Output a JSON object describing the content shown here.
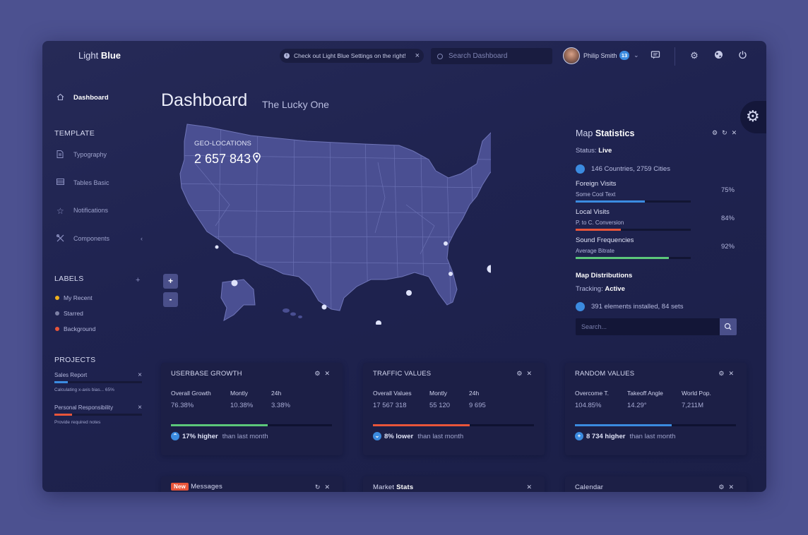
{
  "header": {
    "logo_light": "Light",
    "logo_bold": "Blue",
    "notice_text": "Check out Light Blue Settings on the right!",
    "search_placeholder": "Search Dashboard",
    "user_name": "Philip Smith",
    "notification_count": "13"
  },
  "sidebar": {
    "active_item": "Dashboard",
    "template_heading": "TEMPLATE",
    "items": [
      {
        "label": "Typography",
        "icon": "document-icon"
      },
      {
        "label": "Tables Basic",
        "icon": "table-icon"
      },
      {
        "label": "Notifications",
        "icon": "star-icon"
      },
      {
        "label": "Components",
        "icon": "components-icon"
      }
    ],
    "labels_heading": "LABELS",
    "labels": [
      {
        "label": "My Recent",
        "color": "#f0b01d"
      },
      {
        "label": "Starred",
        "color": "#7d81a6"
      },
      {
        "label": "Background",
        "color": "#e8553a"
      }
    ],
    "projects_heading": "PROJECTS",
    "projects": [
      {
        "name": "Sales Report",
        "progress": 0.15,
        "color": "#3b8be0",
        "note": "Calculating x-axis bias... 65%"
      },
      {
        "name": "Personal Responsibility",
        "progress": 0.2,
        "color": "#e8553a",
        "note": "Provide required notes"
      }
    ]
  },
  "main": {
    "title": "Dashboard",
    "subtitle": "The Lucky One",
    "geo_label": "GEO-LOCATIONS",
    "geo_value": "2 657 843",
    "zoom_in": "+",
    "zoom_out": "-"
  },
  "map_statistics": {
    "title_light": "Map",
    "title_bold": "Statistics",
    "status_label": "Status:",
    "status_value": "Live",
    "countries_text": "146 Countries, 2759 Cities",
    "stats": [
      {
        "name": "Foreign Visits",
        "sub": "Some Cool Text",
        "percent": "75%",
        "value": 0.6,
        "color": "#3b8be0"
      },
      {
        "name": "Local Visits",
        "sub": "P. to C. Conversion",
        "percent": "84%",
        "value": 0.39,
        "color": "#e8553a"
      },
      {
        "name": "Sound Frequencies",
        "sub": "Average Bitrate",
        "percent": "92%",
        "value": 0.81,
        "color": "#5cc87a"
      }
    ],
    "distributions_heading": "Map Distributions",
    "tracking_label": "Tracking:",
    "tracking_value": "Active",
    "elements_text": "391 elements installed, 84 sets",
    "search_placeholder": "Search..."
  },
  "widgets": [
    {
      "title": "USERBASE GROWTH",
      "cols": [
        {
          "k": "Overall Growth",
          "v": "76.38%"
        },
        {
          "k": "Montly",
          "v": "10.38%"
        },
        {
          "k": "24h",
          "v": "3.38%"
        }
      ],
      "progress": 0.6,
      "color": "#5cc87a",
      "foot_bold": "17% higher",
      "foot_rest": "than last month",
      "arrow": "^"
    },
    {
      "title": "TRAFFIC VALUES",
      "cols": [
        {
          "k": "Overall Values",
          "v": "17 567 318"
        },
        {
          "k": "Montly",
          "v": "55 120"
        },
        {
          "k": "24h",
          "v": "9 695"
        }
      ],
      "progress": 0.6,
      "color": "#e8553a",
      "foot_bold": "8% lower",
      "foot_rest": "than last month",
      "arrow": "v"
    },
    {
      "title": "RANDOM VALUES",
      "cols": [
        {
          "k": "Overcome T.",
          "v": "104.85%"
        },
        {
          "k": "Takeoff Angle",
          "v": "14.29°"
        },
        {
          "k": "World Pop.",
          "v": "7,211M"
        }
      ],
      "progress": 0.6,
      "color": "#3b8be0",
      "foot_bold": "8 734 higher",
      "foot_rest": "than last month",
      "arrow": "+"
    }
  ],
  "bottom_widgets": {
    "messages_badge": "New",
    "messages_title": "Messages",
    "market_light": "Market",
    "market_bold": "Stats",
    "calendar_title": "Calendar"
  }
}
